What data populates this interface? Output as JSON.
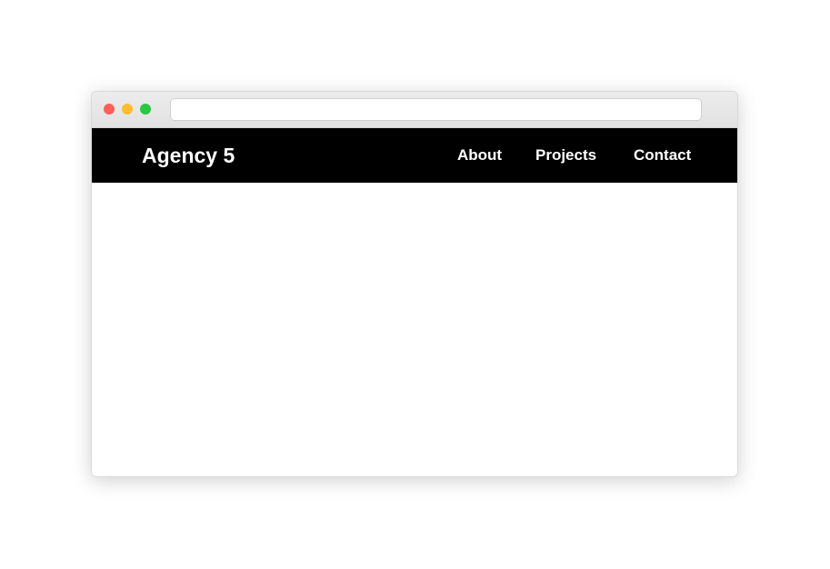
{
  "window": {
    "traffic_lights": [
      {
        "name": "close",
        "color": "#fe5f57"
      },
      {
        "name": "minimize",
        "color": "#febc2e"
      },
      {
        "name": "maximize",
        "color": "#28c840"
      }
    ],
    "address_bar": {
      "value": ""
    }
  },
  "site": {
    "logo": "Agency 5",
    "nav": {
      "about": "About",
      "projects": "Projects",
      "contact": "Contact"
    },
    "colors": {
      "header_background": "#000000",
      "header_text": "#ffffff",
      "page_background": "#ffffff"
    }
  }
}
